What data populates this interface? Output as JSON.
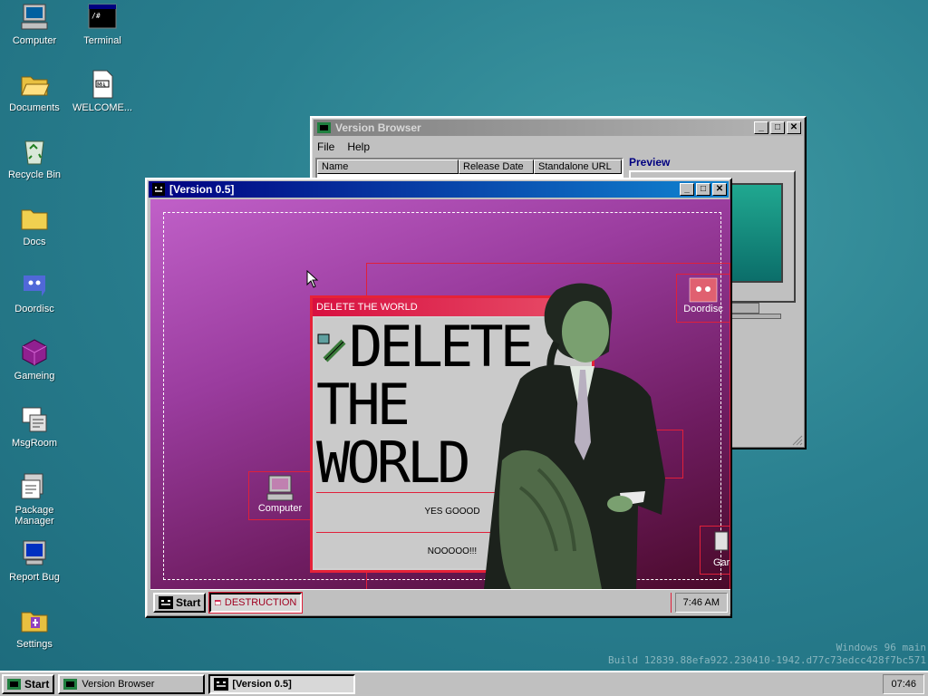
{
  "desktop_icons": [
    {
      "label": "Computer",
      "icon": "computer-icon"
    },
    {
      "label": "Terminal",
      "icon": "terminal-icon"
    },
    {
      "label": "Documents",
      "icon": "folder-open-icon"
    },
    {
      "label": "WELCOME...",
      "icon": "markdown-file-icon"
    },
    {
      "label": "Recycle Bin",
      "icon": "recycle-bin-icon"
    },
    {
      "label": "Docs",
      "icon": "folder-icon"
    },
    {
      "label": "Doordisc",
      "icon": "doordisc-icon"
    },
    {
      "label": "Gameing",
      "icon": "cube-icon"
    },
    {
      "label": "MsgRoom",
      "icon": "msgroom-icon"
    },
    {
      "label": "Package Manager",
      "icon": "package-manager-icon"
    },
    {
      "label": "Report Bug",
      "icon": "report-bug-icon"
    },
    {
      "label": "Settings",
      "icon": "settings-icon"
    }
  ],
  "version_browser": {
    "title": "Version Browser",
    "menu": [
      "File",
      "Help"
    ],
    "columns": [
      "Name",
      "Release Date",
      "Standalone URL"
    ],
    "preview_label": "Preview"
  },
  "inner_window": {
    "title": "[Version 0.5]",
    "icons": [
      {
        "label": "Doordisc",
        "icon": "doordisc-icon"
      },
      {
        "label": "Computer",
        "icon": "computer-icon"
      },
      {
        "label": "Gar",
        "icon": "game-icon"
      }
    ],
    "delete_window": {
      "title": "DELETE THE WORLD",
      "big_lines": [
        "DELETE",
        "THE",
        "WORLD"
      ],
      "yes_label": "YES GOOOD",
      "no_label": "NOOOOO!!!"
    },
    "taskbar": {
      "start_label": "Start",
      "task_label": "DESTRUCTION",
      "clock": "7:46 AM"
    }
  },
  "taskbar": {
    "start_label": "Start",
    "tasks": [
      "Version Browser",
      "[Version 0.5]"
    ],
    "clock": "07:46"
  },
  "watermark": {
    "line1": "Windows 96 main",
    "line2": "Build 12839.88efa922.230410-1942.d77c73edcc428f7bc571"
  },
  "colors": {
    "desktop": "#2a8090",
    "accent_red": "#e62238",
    "titlebar_active": "#000080"
  }
}
